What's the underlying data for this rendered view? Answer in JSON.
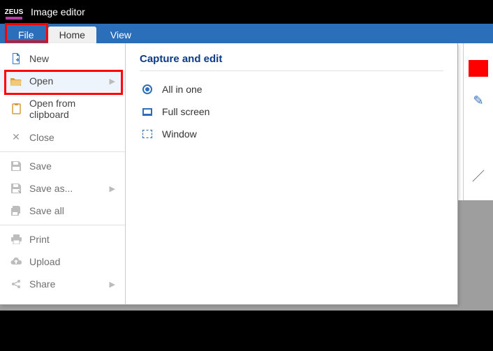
{
  "title": "Image editor",
  "logo_text": "ZEUS",
  "tabs": {
    "file": "File",
    "home": "Home",
    "view": "View"
  },
  "backstage": {
    "items": [
      {
        "label": "New"
      },
      {
        "label": "Open"
      },
      {
        "label": "Open from clipboard"
      },
      {
        "label": "Close"
      },
      {
        "label": "Save"
      },
      {
        "label": "Save as..."
      },
      {
        "label": "Save all"
      },
      {
        "label": "Print"
      },
      {
        "label": "Upload"
      },
      {
        "label": "Share"
      }
    ],
    "panel_title": "Capture and edit",
    "options": [
      {
        "label": "All in one"
      },
      {
        "label": "Full screen"
      },
      {
        "label": "Window"
      }
    ]
  },
  "highlights": {
    "file_tab": true,
    "open_item": true
  }
}
